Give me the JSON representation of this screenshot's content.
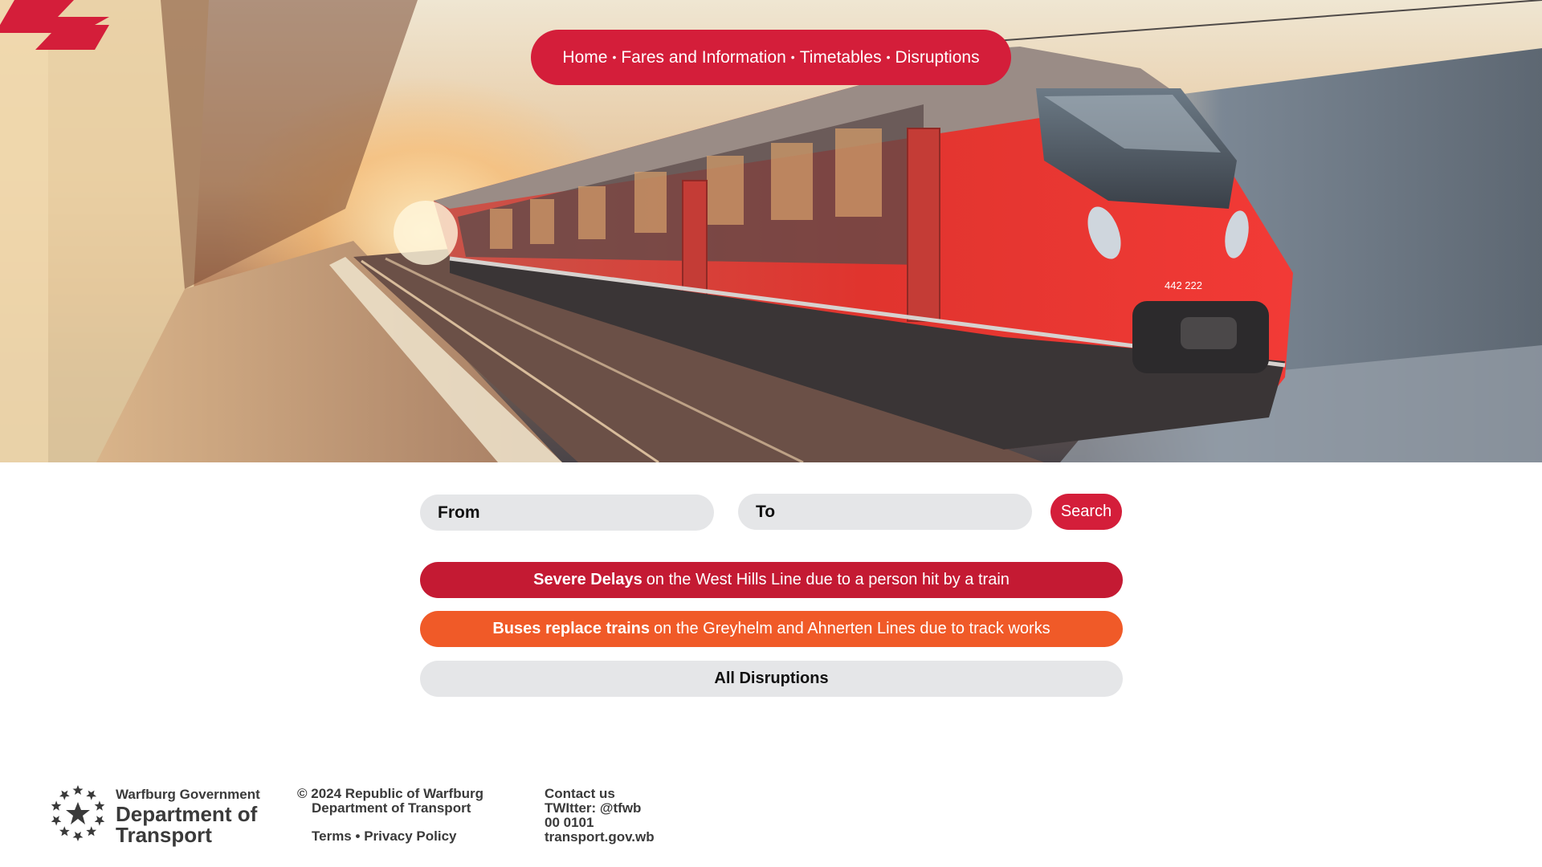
{
  "nav": {
    "items": [
      "Home",
      "Fares and Information",
      "Timetables",
      "Disruptions"
    ],
    "separator": "•"
  },
  "hero": {
    "train_number": "442 222"
  },
  "search": {
    "from_placeholder": "From",
    "to_placeholder": "To",
    "button_label": "Search"
  },
  "alerts": [
    {
      "bold": "Severe Delays",
      "text": "on the West Hills Line due to a person hit by a train",
      "color": "#c41a33"
    },
    {
      "bold": "Buses replace trains",
      "text": "on the Greyhelm and Ahnerten Lines due to track works",
      "color": "#f05a28"
    }
  ],
  "all_disruptions_label": "All Disruptions",
  "footer": {
    "government": "Warfburg Government",
    "department": "Department of Transport",
    "copyright_line1": "© 2024 Republic of Warfburg",
    "copyright_line2": "Department of Transport",
    "terms": "Terms",
    "legal_separator": "•",
    "privacy": "Privacy Policy",
    "contact_heading": "Contact us",
    "twitter": "TWItter: @tfwb",
    "phone": "00 0101",
    "website": "transport.gov.wb"
  },
  "colors": {
    "brand_red": "#d41e3a",
    "alert_red": "#c41a33",
    "alert_orange": "#f05a28",
    "field_grey": "#e5e6e8"
  },
  "icons": {
    "logo": "double-arrow-logo-icon",
    "seal": "star-ring-seal-icon"
  }
}
